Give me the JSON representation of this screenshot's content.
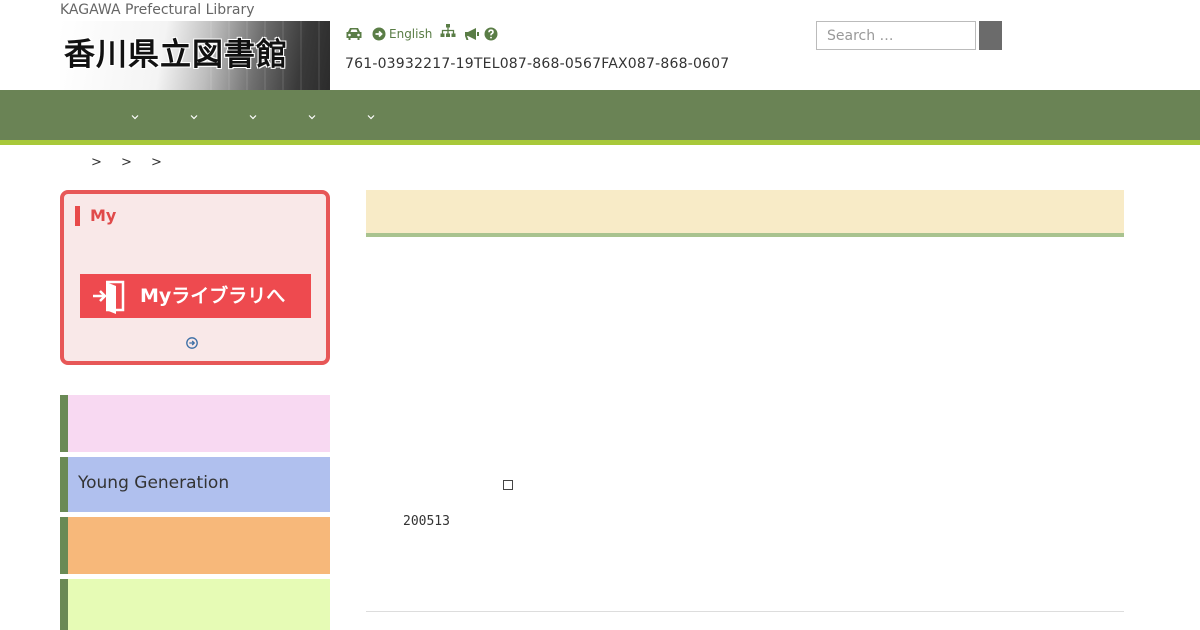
{
  "header": {
    "site_subtitle": "KAGAWA Prefectural Library",
    "logo_text": "香川県立図書館",
    "contact": "761-03932217-19TEL087-868-0567FAX087-868-0607",
    "english_label": "English"
  },
  "tools": {
    "icons": [
      "car-icon",
      "circle-arrow-right-icon",
      "sitemap-icon",
      "bullhorn-icon",
      "question-circle-icon"
    ]
  },
  "search": {
    "placeholder": "Search …",
    "value": ""
  },
  "nav": {
    "items": [
      "",
      "",
      "",
      "",
      ""
    ]
  },
  "breadcrumb": {
    "separators": [
      ">",
      ">",
      ">"
    ]
  },
  "mylibrary": {
    "title": "My",
    "button_label": "Myライブラリへ"
  },
  "side_panels": [
    {
      "label": "",
      "color": "#f8d9f2"
    },
    {
      "label": "Young Generation",
      "color": "#b0c0ee"
    },
    {
      "label": "",
      "color": "#f7b87a"
    },
    {
      "label": "",
      "color": "#e6fbb5"
    }
  ],
  "main": {
    "code_number": "200513"
  },
  "colors": {
    "nav": "#6a8355",
    "nav_accent": "#a8c83a",
    "mylibrary_border": "#e75757",
    "mylibrary_button": "#ee4a4f",
    "main_header": "#f8ebc7",
    "main_header_line": "#a9c38f"
  }
}
